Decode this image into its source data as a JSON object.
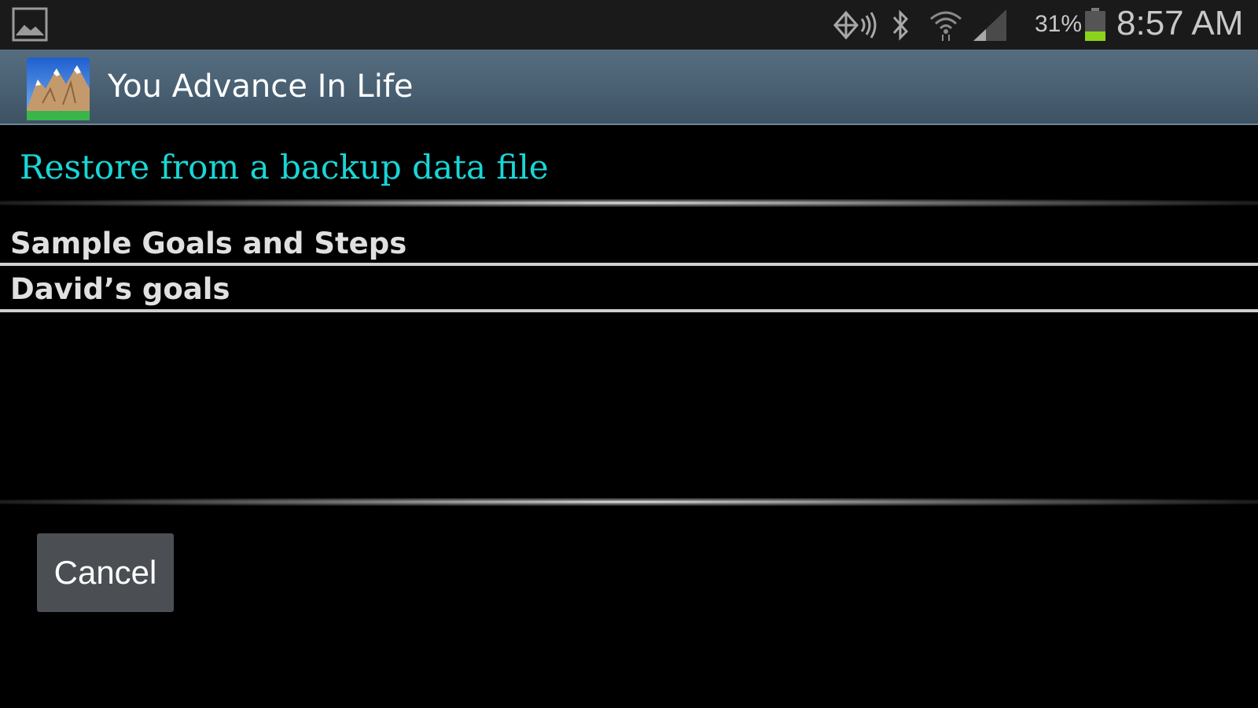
{
  "status_bar": {
    "battery_percent": "31%",
    "battery_level": 0.31,
    "time": "8:57 AM",
    "icons": [
      "image-notification-icon",
      "nfc-icon",
      "bluetooth-icon",
      "wifi-icon",
      "signal-icon",
      "battery-icon"
    ]
  },
  "action_bar": {
    "app_title": "You Advance In Life",
    "app_icon": "mountain-app-icon"
  },
  "dialog": {
    "title": "Restore from a backup data file",
    "items": [
      {
        "label": "Sample Goals and Steps"
      },
      {
        "label": "David’s goals"
      }
    ],
    "cancel_label": "Cancel"
  },
  "colors": {
    "title_accent": "#19d6d6",
    "action_bar": "#4a6174",
    "battery_fill": "#8bd31a",
    "button_bg": "#4b4f54"
  }
}
